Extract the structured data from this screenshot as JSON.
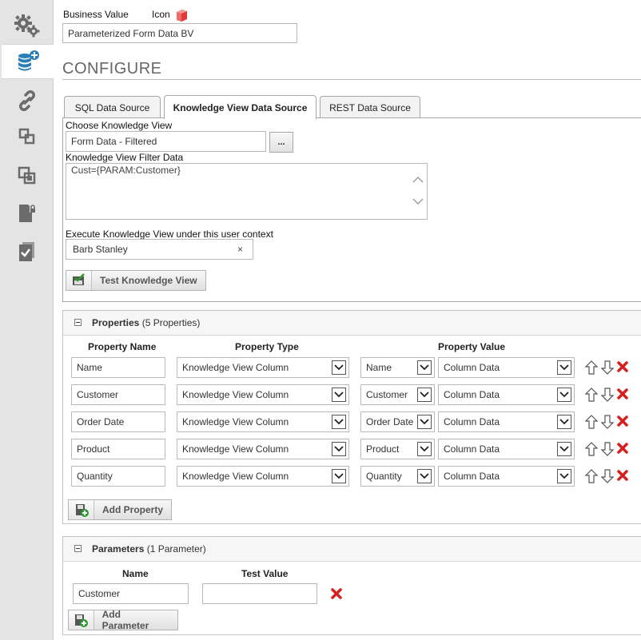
{
  "sidebar": {
    "items": [
      {
        "icon": "gears-icon"
      },
      {
        "icon": "database-add-icon",
        "active": true
      },
      {
        "icon": "link-icon"
      },
      {
        "icon": "copy-icon"
      },
      {
        "icon": "duplicate-icon"
      },
      {
        "icon": "locked-page-icon"
      },
      {
        "icon": "checked-page-icon"
      }
    ]
  },
  "header": {
    "business_value_label": "Business Value",
    "icon_label": "Icon",
    "business_value": "Parameterized Form Data BV",
    "icon_color": "#e03a3a"
  },
  "configure": {
    "title": "CONFIGURE",
    "tabs": [
      {
        "label": "SQL Data Source",
        "active": false
      },
      {
        "label": "Knowledge View Data Source",
        "active": true
      },
      {
        "label": "REST Data Source",
        "active": false
      }
    ],
    "choose_kv_label": "Choose Knowledge View",
    "choose_kv_value": "Form Data - Filtered",
    "browse_label": "...",
    "filter_label": "Knowledge View Filter Data",
    "filter_value": "Cust={PARAM:Customer}",
    "context_label": "Execute Knowledge View under this user context",
    "context_value": "Barb Stanley",
    "context_clear": "×",
    "test_button": "Test Knowledge View"
  },
  "properties": {
    "title": "Properties",
    "count": "(5 Properties)",
    "headers": {
      "name": "Property Name",
      "type": "Property Type",
      "value": "Property Value"
    },
    "rows": [
      {
        "name": "Name",
        "type": "Knowledge View Column",
        "column": "Name",
        "value": "Column Data"
      },
      {
        "name": "Customer",
        "type": "Knowledge View Column",
        "column": "Customer",
        "value": "Column Data"
      },
      {
        "name": "Order Date",
        "type": "Knowledge View Column",
        "column": "Order Date",
        "value": "Column Data"
      },
      {
        "name": "Product",
        "type": "Knowledge View Column",
        "column": "Product",
        "value": "Column Data"
      },
      {
        "name": "Quantity",
        "type": "Knowledge View Column",
        "column": "Quantity",
        "value": "Column Data"
      }
    ],
    "add_button": "Add Property"
  },
  "parameters": {
    "title": "Parameters",
    "count": "(1 Parameter)",
    "headers": {
      "name": "Name",
      "test_value": "Test Value"
    },
    "rows": [
      {
        "name": "Customer",
        "test_value": ""
      }
    ],
    "add_button": "Add Parameter"
  },
  "colors": {
    "delete_red": "#d62020",
    "sidebar_icon": "#6b6b6b",
    "active_icon": "#2a7fb8"
  }
}
